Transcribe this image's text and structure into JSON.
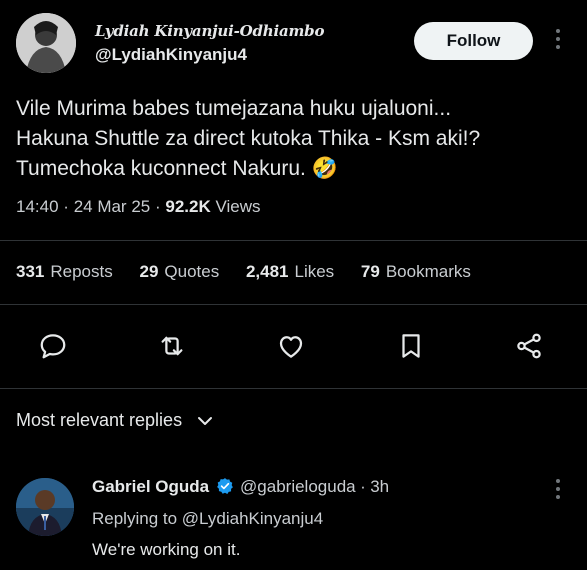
{
  "tweet": {
    "author_name": "Lydiah Kinyanjui-Odhiambo",
    "author_handle": "@LydiahKinyanju4",
    "follow_label": "Follow",
    "text_line1": "Vile Murima babes tumejazana huku ujaluoni...",
    "text_line2": "Hakuna Shuttle za direct kutoka Thika - Ksm aki!?",
    "text_line3": "Tumechoka kuconnect Nakuru. 🤣",
    "time": "14:40",
    "date": "24 Mar 25",
    "views_count": "92.2K",
    "views_label": "Views",
    "sep": "·"
  },
  "stats": {
    "reposts_count": "331",
    "reposts_label": "Reposts",
    "quotes_count": "29",
    "quotes_label": "Quotes",
    "likes_count": "2,481",
    "likes_label": "Likes",
    "bookmarks_count": "79",
    "bookmarks_label": "Bookmarks"
  },
  "actions": [
    "reply-icon",
    "repost-icon",
    "like-icon",
    "bookmark-icon",
    "share-icon"
  ],
  "replies_section": {
    "title": "Most relevant replies",
    "chevron": "chevron-down-icon"
  },
  "reply": {
    "author_name": "Gabriel Oguda",
    "author_handle": "@gabrieloguda",
    "time": "3h",
    "sep": "·",
    "replying_to_prefix": "Replying to",
    "replying_to_handle": "@LydiahKinyanju4",
    "text": "We're working on it."
  },
  "colors": {
    "background": "#000000",
    "text": "#e7e9ea",
    "muted": "#71767b",
    "divider": "#2f3336",
    "verified": "#1d9bf0"
  }
}
